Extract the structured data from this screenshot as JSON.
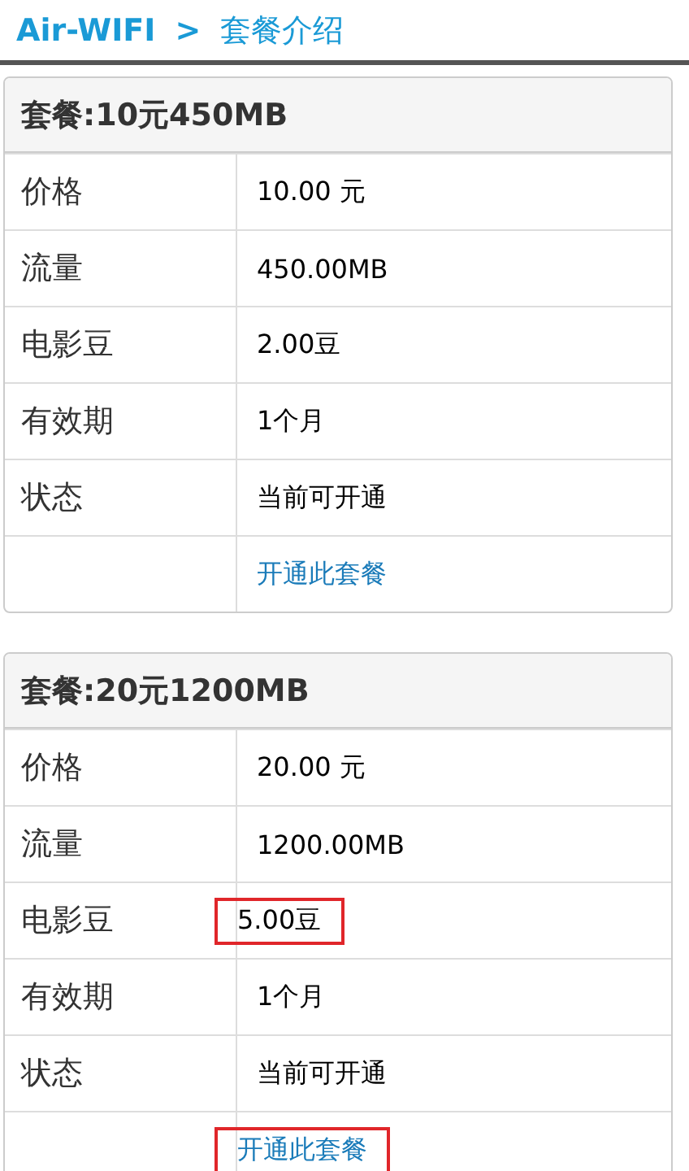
{
  "breadcrumb": [
    "Air-WIFI",
    ">",
    "套餐介绍"
  ],
  "plans": [
    {
      "title": "套餐:10元450MB",
      "rows": [
        {
          "kind": "text",
          "label": "价格",
          "value": "10.00 元",
          "marked": false
        },
        {
          "kind": "text",
          "label": "流量",
          "value": "450.00MB",
          "marked": false
        },
        {
          "kind": "text",
          "label": "电影豆",
          "value": "2.00豆",
          "marked": false
        },
        {
          "kind": "text",
          "label": "有效期",
          "value": "1个月",
          "marked": false
        },
        {
          "kind": "text",
          "label": "状态",
          "value": "当前可开通",
          "marked": false
        },
        {
          "kind": "link",
          "value": "开通此套餐",
          "marked": false
        }
      ]
    },
    {
      "title": "套餐:20元1200MB",
      "rows": [
        {
          "kind": "text",
          "label": "价格",
          "value": "20.00 元",
          "marked": false
        },
        {
          "kind": "text",
          "label": "流量",
          "value": "1200.00MB",
          "marked": false
        },
        {
          "kind": "text",
          "label": "电影豆",
          "value": "5.00豆",
          "marked": true
        },
        {
          "kind": "text",
          "label": "有效期",
          "value": "1个月",
          "marked": false
        },
        {
          "kind": "text",
          "label": "状态",
          "value": "当前可开通",
          "marked": false
        },
        {
          "kind": "link",
          "value": "开通此套餐",
          "marked": true
        }
      ]
    }
  ]
}
